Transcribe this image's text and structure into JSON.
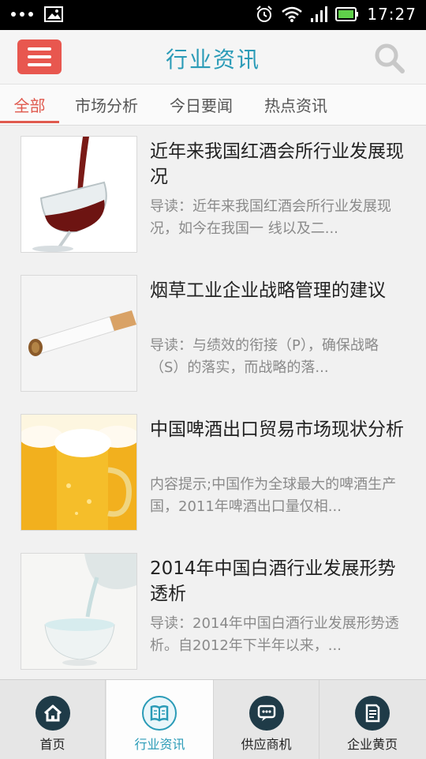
{
  "status_bar": {
    "time": "17:27"
  },
  "header": {
    "title": "行业资讯"
  },
  "tabs": [
    {
      "label": "全部"
    },
    {
      "label": "市场分析"
    },
    {
      "label": "今日要闻"
    },
    {
      "label": "热点资讯"
    }
  ],
  "articles": [
    {
      "title": "近年来我国红酒会所行业发展现况",
      "desc": "导读：近年来我国红酒会所行业发展现况，如今在我国一 线以及二..."
    },
    {
      "title": "烟草工业企业战略管理的建议",
      "desc": "导读：与绩效的衔接（P），确保战略（S）的落实，而战略的落..."
    },
    {
      "title": "中国啤酒出口贸易市场现状分析",
      "desc": "内容提示;中国作为全球最大的啤酒生产国，2011年啤酒出口量仅相..."
    },
    {
      "title": "2014年中国白酒行业发展形势透析",
      "desc": "导读：2014年中国白酒行业发展形势透析。自2012年下半年以来，..."
    }
  ],
  "bottom_nav": [
    {
      "label": "首页"
    },
    {
      "label": "行业资讯"
    },
    {
      "label": "供应商机"
    },
    {
      "label": "企业黄页"
    }
  ]
}
